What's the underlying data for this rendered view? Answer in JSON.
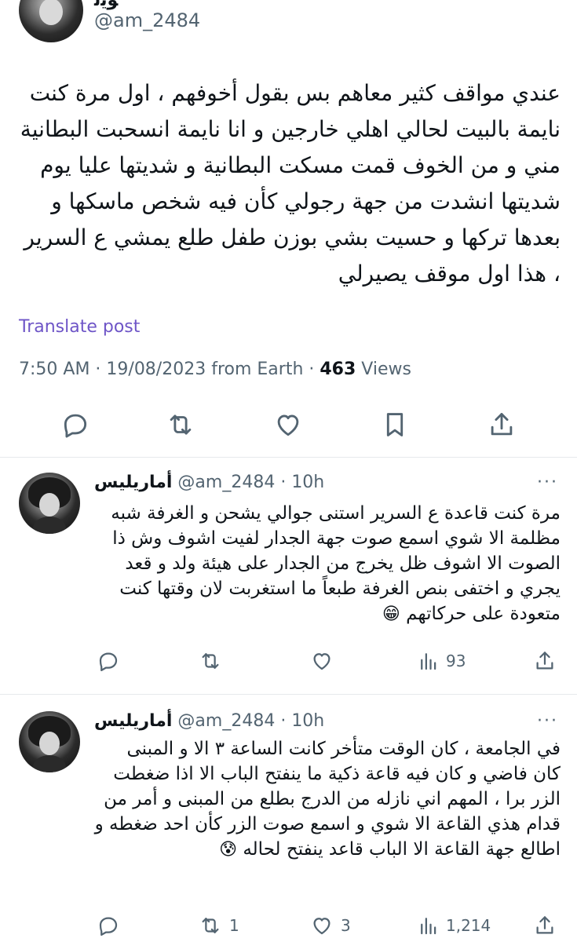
{
  "main_post": {
    "author_name_fragment": "ﻮﻳﻟ",
    "handle": "@am_2484",
    "text": "عندي مواقف كثير معاهم بس بقول أخوفهم ، اول مرة كنت نايمة بالبيت لحالي اهلي خارجين و انا نايمة انسحبت البطانية مني و من الخوف قمت مسكت البطانية و شديتها عليا يوم شديتها انشدت من جهة رجولي كأن فيه شخص ماسكها و بعدها تركها و حسيت بشي بوزن طفل طلع يمشي ع السرير ، هذا اول موقف يصيرلي",
    "translate_label": "Translate post",
    "meta_prefix": "7:50 AM · 19/08/2023 from Earth · ",
    "views_count": "463",
    "views_label": " Views"
  },
  "main_actions": {
    "icons": [
      "reply-icon",
      "retweet-icon",
      "like-icon",
      "bookmark-icon",
      "share-icon"
    ]
  },
  "replies": [
    {
      "name": "أماريليس",
      "handle": "@am_2484",
      "time": "· 10h",
      "more": "···",
      "text": "مرة كنت قاعدة ع السرير استنى جوالي يشحن و الغرفة شبه مظلمة الا شوي اسمع صوت جهة الجدار لفيت اشوف وش ذا الصوت الا اشوف ظل يخرج من الجدار على هيئة ولد و قعد يجري و اختفى بنص الغرفة طبعاً ما استغربت لان وقتها كنت متعودة على حركاتهم",
      "emoji": "😁",
      "reply_count": "",
      "retweet_count": "",
      "like_count": "",
      "views_count": "93"
    },
    {
      "name": "أماريليس",
      "handle": "@am_2484",
      "time": "· 10h",
      "more": "···",
      "text": "في الجامعة ، كان الوقت متأخر كانت الساعة ٣ الا و المبنى كان فاضي و كان فيه قاعة ذكية ما ينفتح الباب الا اذا ضغطت الزر برا ، المهم اني نازله من الدرج بطلع من المبنى و أمر من قدام هذي القاعة الا شوي و اسمع صوت الزر كأن احد ضغطه و اطالع جهة القاعة الا الباب قاعد ينفتح لحاله",
      "emoji": "😰",
      "reply_count": "",
      "retweet_count": "1",
      "like_count": "3",
      "views_count": "1,214"
    }
  ],
  "colors": {
    "text": "#0f1419",
    "secondary": "#536471",
    "translate": "#6e55c7",
    "divider": "#e6e9ec"
  }
}
